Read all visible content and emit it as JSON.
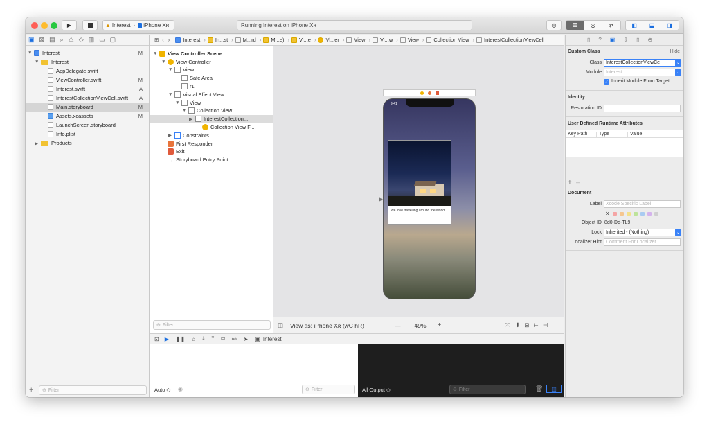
{
  "toolbar": {
    "scheme": "Interest",
    "device": "iPhone Xʀ",
    "activity": "Running Interest on iPhone Xʀ"
  },
  "navigator": {
    "project": "Interest",
    "group": "Interest",
    "files": [
      {
        "name": "AppDelegate.swift",
        "badge": ""
      },
      {
        "name": "ViewController.swift",
        "badge": "M"
      },
      {
        "name": "Interest.swift",
        "badge": "A"
      },
      {
        "name": "InterestCollectionViewCell.swift",
        "badge": "A"
      },
      {
        "name": "Main.storyboard",
        "badge": "M"
      },
      {
        "name": "Assets.xcassets",
        "badge": "M"
      },
      {
        "name": "LaunchScreen.storyboard",
        "badge": ""
      },
      {
        "name": "Info.plist",
        "badge": ""
      }
    ],
    "project_badge": "M",
    "products": "Products",
    "filter_placeholder": "Filter"
  },
  "jumpbar": {
    "crumbs": [
      "Interest",
      "In...st",
      "M...rd",
      "M...e)",
      "Vi...e",
      "Vi...er",
      "View",
      "Vi...w",
      "View",
      "Collection View",
      "InterestCollectionViewCell"
    ]
  },
  "outline": {
    "scene": "View Controller Scene",
    "rows": [
      "View Controller",
      "View",
      "Safe Area",
      "r1",
      "Visual Effect View",
      "View",
      "Collection View",
      "InterestCollection...",
      "Collection View Fl...",
      "Constraints",
      "First Responder",
      "Exit",
      "Storyboard Entry Point"
    ],
    "filter_placeholder": "Filter"
  },
  "canvas": {
    "phone_time": "9:41",
    "cell_caption": "We love travelling around the world",
    "view_as": "View as: iPhone Xʀ (wC hR)",
    "zoom": "49%"
  },
  "debug": {
    "target": "Interest",
    "auto_label": "Auto ◇",
    "all_output": "All Output ◇",
    "filter_placeholder": "Filter"
  },
  "inspector": {
    "custom_class": "Custom Class",
    "hide": "Hide",
    "class_label": "Class",
    "class_value": "InterestCollectionViewCe",
    "module_label": "Module",
    "module_placeholder": "Interest",
    "inherit": "Inherit Module From Target",
    "identity": "Identity",
    "restoration_label": "Restoration ID",
    "udra": "User Defined Runtime Attributes",
    "col_key": "Key Path",
    "col_type": "Type",
    "col_value": "Value",
    "document": "Document",
    "label_label": "Label",
    "label_placeholder": "Xcode Specific Label",
    "object_id_label": "Object ID",
    "object_id": "8d0-Dd-TL9",
    "lock_label": "Lock",
    "lock_value": "Inherited - (Nothing)",
    "hint_label": "Localizer Hint",
    "hint_placeholder": "Comment For Localizer"
  }
}
